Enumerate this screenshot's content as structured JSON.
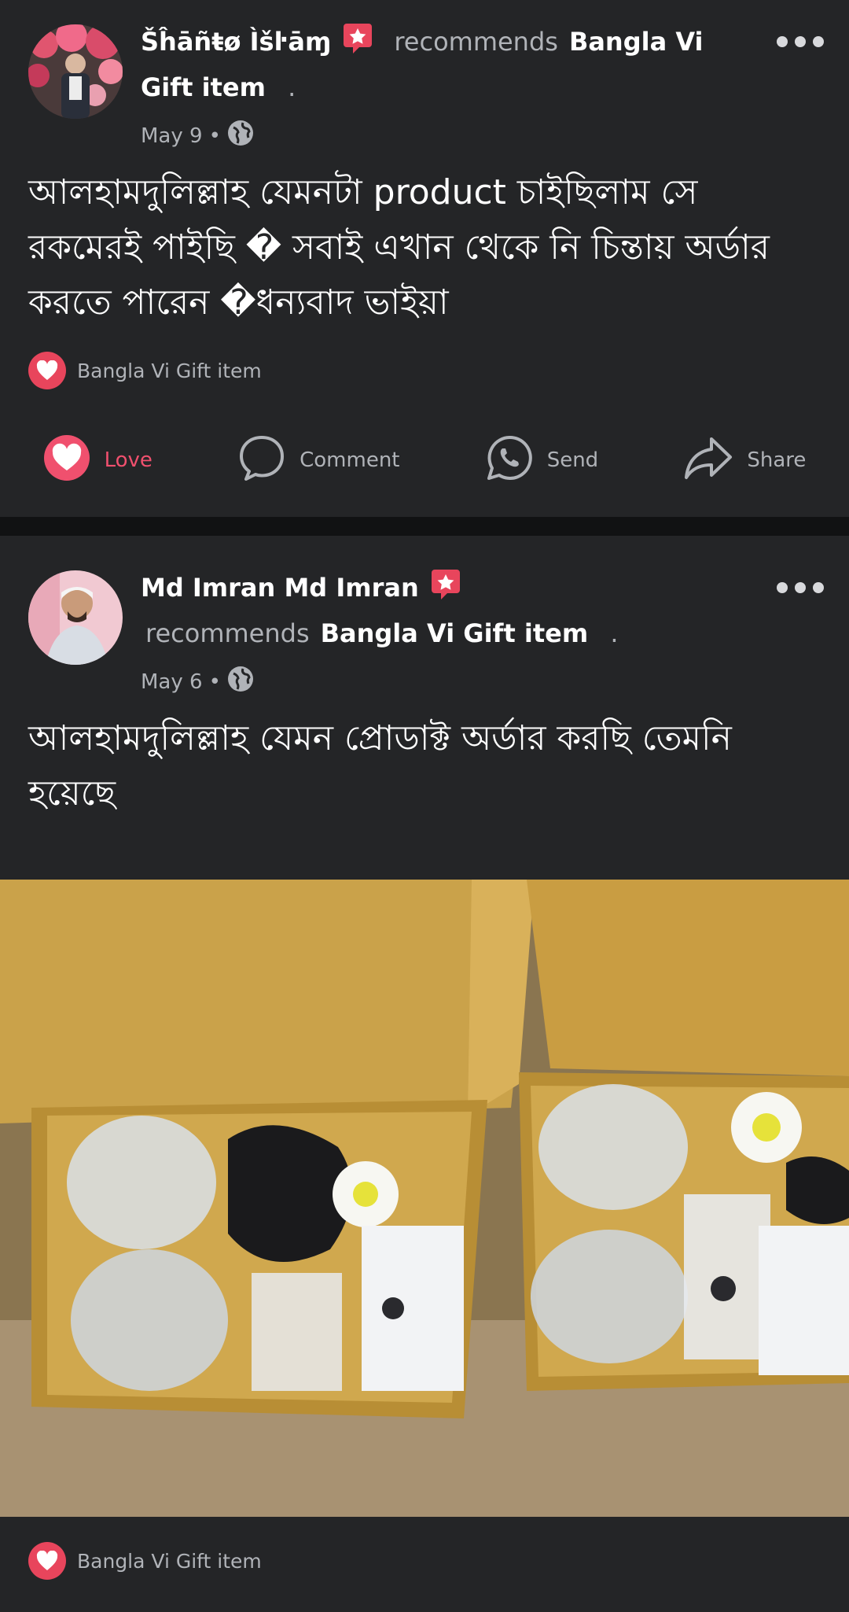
{
  "posts": [
    {
      "author": "Šĥāñŧø Ìšŀāɱ",
      "recommends": "recommends",
      "page": "Bangla Vi Gift item",
      "trailing": ".",
      "date": "May 9",
      "text": "আলহামদুলিল্লাহ যেমনটা product চাইছিলাম সে রকমেরই পাইছি � সবাই এখান থেকে নি চিন্তায় অর্ডার করতে পারেন  �ধন্যবাদ ভাইয়া",
      "reaction_label": "Bangla Vi Gift item",
      "actions": {
        "love": "Love",
        "comment": "Comment",
        "send": "Send",
        "share": "Share"
      }
    },
    {
      "author": "Md Imran Md Imran",
      "recommends": "recommends",
      "page": "Bangla Vi Gift item",
      "trailing": ".",
      "date": "May 6",
      "text": "আলহামদুলিল্লাহ যেমন প্রোডাক্ট অর্ডার করছি তেমনি হয়েছে",
      "reaction_label": "Bangla Vi Gift item"
    }
  ],
  "icons": {
    "more": "more-horizontal-icon",
    "globe": "globe-icon",
    "star": "recommendation-star-icon",
    "heart": "heart-icon",
    "comment": "comment-bubble-icon",
    "whatsapp": "whatsapp-send-icon",
    "share": "share-arrow-icon"
  },
  "colors": {
    "background": "#242527",
    "love": "#f0506e",
    "heart_badge": "#e8455c",
    "muted_text": "#b0b3b8"
  }
}
